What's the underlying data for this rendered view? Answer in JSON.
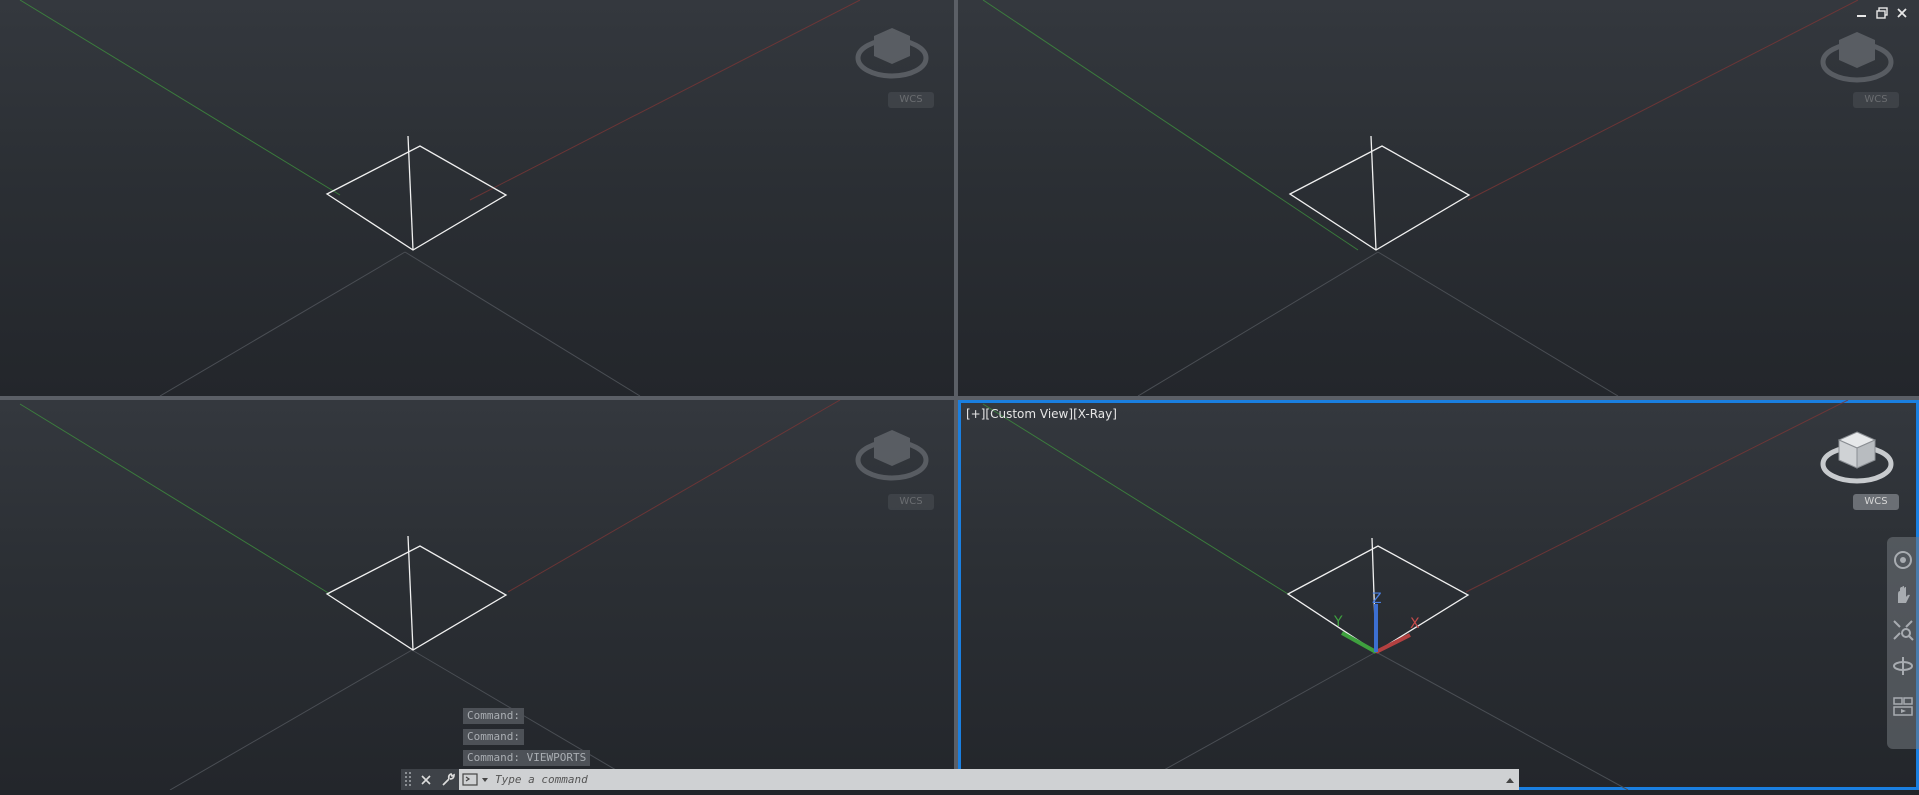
{
  "viewports": {
    "active_label": {
      "plus": "[+]",
      "view": "[Custom View]",
      "style": "[X-Ray]"
    },
    "wcs_label": "WCS",
    "axis_labels": {
      "x": "X",
      "y": "Y",
      "z": "Z"
    }
  },
  "command": {
    "history": [
      "Command:",
      "Command:",
      "Command: VIEWPORTS"
    ],
    "placeholder": "Type a command"
  },
  "colors": {
    "background": "#2b2f34",
    "active_border": "#1a7fe0",
    "axis_x": "#b34040",
    "axis_y": "#3ea03e",
    "axis_z": "#3c6fd1"
  },
  "icons": {
    "close": "close-icon",
    "customize": "wrench-icon",
    "command_prompt": "command-prompt-icon",
    "expand_history": "chevron-up-icon"
  }
}
